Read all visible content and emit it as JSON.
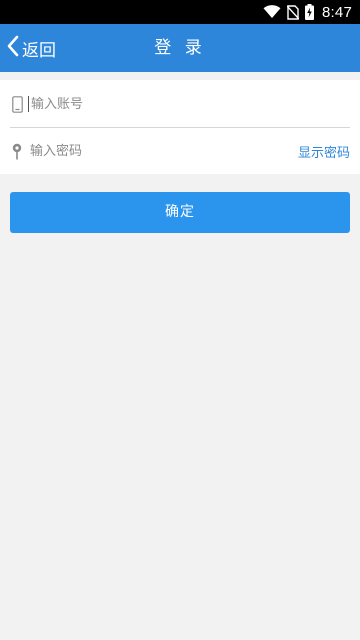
{
  "status_bar": {
    "time": "8:47",
    "icons": [
      "wifi-icon",
      "no-sim-icon",
      "battery-charging-icon"
    ]
  },
  "header": {
    "back_label": "返回",
    "title": "登 录",
    "background_color": "#2d86d9"
  },
  "form": {
    "account": {
      "icon": "phone-icon",
      "placeholder": "输入账号",
      "value": ""
    },
    "password": {
      "icon": "pin-icon",
      "placeholder": "输入密码",
      "value": "",
      "show_password_label": "显示密码"
    }
  },
  "actions": {
    "confirm_label": "确定",
    "button_color": "#2b95ee"
  }
}
